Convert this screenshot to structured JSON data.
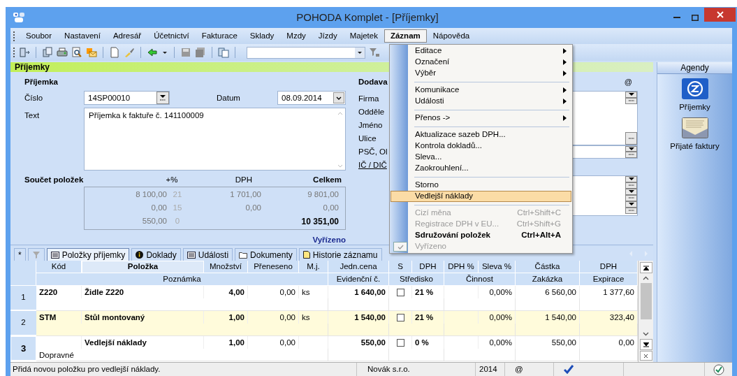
{
  "window": {
    "title": "POHODA Komplet - [Příjemky]"
  },
  "menu_bar": [
    {
      "label": "Soubor",
      "selected": false
    },
    {
      "label": "Nastavení",
      "selected": false
    },
    {
      "label": "Adresář",
      "selected": false
    },
    {
      "label": "Účetnictví",
      "selected": false
    },
    {
      "label": "Fakturace",
      "selected": false
    },
    {
      "label": "Sklady",
      "selected": false
    },
    {
      "label": "Mzdy",
      "selected": false
    },
    {
      "label": "Jízdy",
      "selected": false
    },
    {
      "label": "Majetek",
      "selected": false
    },
    {
      "label": "Záznam",
      "selected": true
    },
    {
      "label": "Nápověda",
      "selected": false
    }
  ],
  "section_header": "Příjemky",
  "receipt": {
    "title": "Příjemka",
    "number_label": "Číslo",
    "number": "14SP00010",
    "date_label": "Datum",
    "date": "08.09.2014",
    "text_label": "Text",
    "text": "Příjemka k faktuře č. 141100009"
  },
  "totals": {
    "title": "Součet položek",
    "columns": [
      "+%",
      "DPH",
      "Celkem"
    ],
    "rows": [
      {
        "base": "8 100,00",
        "rate": "21",
        "vat": "1 701,00",
        "total": "9 801,00"
      },
      {
        "base": "0,00",
        "rate": "15",
        "vat": "0,00",
        "total": "0,00"
      },
      {
        "base": "550,00",
        "rate": "0",
        "vat": "",
        "total": "10 351,00"
      }
    ],
    "status": "Vyřízeno"
  },
  "supplier": {
    "title": "Dodava",
    "at_sign": "@",
    "labels": [
      "Firma",
      "Odděle",
      "Jméno",
      "Ulice",
      "PSČ, Ol",
      "IČ / DIČ"
    ]
  },
  "menu": [
    {
      "kind": "item",
      "label": "Editace",
      "submenu": true,
      "disabled": false,
      "selected": false
    },
    {
      "kind": "item",
      "label": "Označení",
      "submenu": true,
      "disabled": false,
      "selected": false
    },
    {
      "kind": "item",
      "label": "Výběr",
      "submenu": true,
      "disabled": false,
      "selected": false
    },
    {
      "kind": "separator"
    },
    {
      "kind": "item",
      "label": "Komunikace",
      "submenu": true,
      "disabled": false,
      "selected": false
    },
    {
      "kind": "item",
      "label": "Události",
      "submenu": true,
      "disabled": false,
      "selected": false
    },
    {
      "kind": "separator"
    },
    {
      "kind": "item",
      "label": "Přenos ->",
      "submenu": true,
      "disabled": false,
      "selected": false
    },
    {
      "kind": "separator"
    },
    {
      "kind": "item",
      "label": "Aktualizace sazeb DPH...",
      "submenu": false,
      "disabled": false,
      "selected": false
    },
    {
      "kind": "item",
      "label": "Kontrola dokladů...",
      "submenu": false,
      "disabled": false,
      "selected": false
    },
    {
      "kind": "item",
      "label": "Sleva...",
      "submenu": false,
      "disabled": false,
      "selected": false
    },
    {
      "kind": "item",
      "label": "Zaokrouhlení...",
      "submenu": false,
      "disabled": false,
      "selected": false
    },
    {
      "kind": "separator"
    },
    {
      "kind": "item",
      "label": "Storno",
      "submenu": false,
      "disabled": false,
      "selected": false
    },
    {
      "kind": "item",
      "label": "Vedlejší náklady",
      "submenu": false,
      "disabled": false,
      "selected": true
    },
    {
      "kind": "separator"
    },
    {
      "kind": "item",
      "label": "Cizí měna",
      "shortcut": "Ctrl+Shift+C",
      "submenu": false,
      "disabled": true,
      "selected": false
    },
    {
      "kind": "item",
      "label": "Registrace DPH v EU...",
      "shortcut": "Ctrl+Shift+G",
      "submenu": false,
      "disabled": true,
      "selected": false
    },
    {
      "kind": "item",
      "label": "Sdružování položek",
      "shortcut": "Ctrl+Alt+A",
      "submenu": false,
      "disabled": false,
      "selected": false
    },
    {
      "kind": "item",
      "label": "Vyřízeno",
      "submenu": false,
      "disabled": true,
      "selected": false,
      "checked": true
    }
  ],
  "agendas": {
    "title": "Agendy",
    "items": [
      {
        "label": "Příjemky",
        "kind": "receipt"
      },
      {
        "label": "Přijaté faktury",
        "kind": "invoice"
      }
    ]
  },
  "tabs": [
    {
      "label": "*",
      "kind": "new",
      "selected": false
    },
    {
      "kind": "filter",
      "selected": false
    },
    {
      "label": "Položky příjemky",
      "kind": "list",
      "selected": true
    },
    {
      "label": "Doklady",
      "kind": "info",
      "selected": false
    },
    {
      "label": "Události",
      "kind": "list",
      "selected": false
    },
    {
      "label": "Dokumenty",
      "kind": "folder",
      "selected": false
    },
    {
      "label": "Historie záznamu",
      "kind": "page",
      "selected": false
    }
  ],
  "table": {
    "columns": [
      "Kód",
      "Položka",
      "Množství",
      "Přeneseno",
      "M.j.",
      "Jedn.cena",
      "S",
      "DPH",
      "DPH %",
      "Sleva %",
      "Částka",
      "DPH"
    ],
    "sub_columns": [
      "Poznámka",
      "Evidenční č.",
      "Středisko",
      "Činnost",
      "Zakázka",
      "Expirace"
    ],
    "rows": [
      {
        "number": "1",
        "code": "Z220",
        "item": "Židle Z220",
        "quantity": "4,00",
        "transferred": "0,00",
        "unit": "ks",
        "unit_price": "1 640,00",
        "s_checked": false,
        "vat_rate": "21 %",
        "discount": "0,00%",
        "amount": "6 560,00",
        "vat": "1 377,60",
        "highlighted": false,
        "current": false
      },
      {
        "number": "2",
        "code": "STM",
        "item": "Stůl montovaný",
        "quantity": "1,00",
        "transferred": "0,00",
        "unit": "ks",
        "unit_price": "1 540,00",
        "s_checked": false,
        "vat_rate": "21 %",
        "discount": "0,00%",
        "amount": "1 540,00",
        "vat": "323,40",
        "highlighted": true,
        "current": false
      },
      {
        "number": "3",
        "item": "Vedlejší náklady",
        "quantity": "1,00",
        "transferred": "0,00",
        "unit_price": "550,00",
        "s_checked": false,
        "vat_rate": "0 %",
        "discount": "0,00%",
        "amount": "550,00",
        "vat": "0,00",
        "note": "Dopravné",
        "highlighted": false,
        "current": true
      }
    ]
  },
  "status_bar": {
    "message": "Přidá novou položku pro vedlejší náklady.",
    "company": "Novák s.r.o.",
    "year": "2014",
    "at_sign": "@"
  }
}
